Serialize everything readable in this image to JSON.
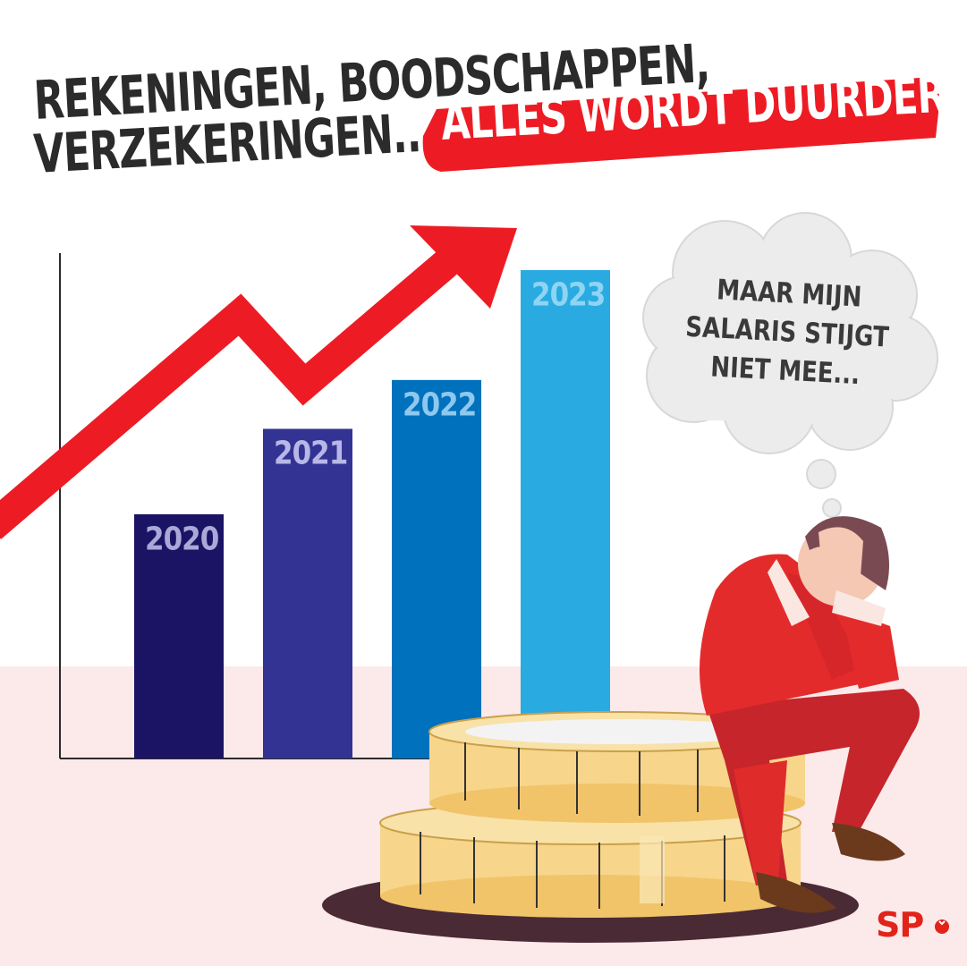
{
  "headline": {
    "line1": "REKENINGEN, BOODSCHAPPEN,",
    "line2": "VERZEKERINGEN",
    "ellipsis": "...",
    "highlight": "ALLES WORDT DUURDER"
  },
  "chart_data": {
    "type": "bar",
    "categories": [
      "2020",
      "2021",
      "2022",
      "2023"
    ],
    "values": [
      1.0,
      1.35,
      1.55,
      2.0
    ],
    "trend": "up",
    "bar_colors": [
      "#1b1464",
      "#333393",
      "#0071bc",
      "#29abe2"
    ],
    "label_colors": [
      "#a9a9d8",
      "#b8b8e8",
      "#8fc8ee",
      "#8fd4f3"
    ],
    "arrow_color": "#ed1c24"
  },
  "thought": {
    "lines": [
      "MAAR MIJN",
      "SALARIS STIJGT",
      "NIET MEE..."
    ]
  },
  "logo": {
    "text": "SP"
  },
  "colors": {
    "accent": "#ed1c24",
    "text_dark": "#2b2b2b",
    "floor": "#fce9ea",
    "coin": "#f7d58b",
    "suit": "#e42b2b"
  }
}
